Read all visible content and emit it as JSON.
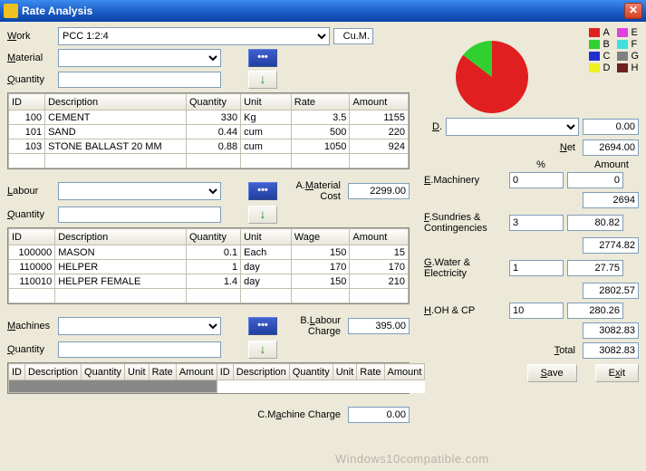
{
  "window": {
    "title": "Rate Analysis"
  },
  "work": {
    "label": "Work",
    "value": "PCC 1:2:4",
    "unit": "Cu.M."
  },
  "material": {
    "label": "Material",
    "qty_label": "Quantity",
    "value": "",
    "qty": ""
  },
  "matTable": {
    "headers": [
      "ID",
      "Description",
      "Quantity",
      "Unit",
      "Rate",
      "Amount"
    ],
    "rows": [
      {
        "id": "100",
        "desc": "CEMENT",
        "qty": "330",
        "unit": "Kg",
        "rate": "3.5",
        "amt": "1155"
      },
      {
        "id": "101",
        "desc": "SAND",
        "qty": "0.44",
        "unit": "cum",
        "rate": "500",
        "amt": "220"
      },
      {
        "id": "103",
        "desc": "STONE BALLAST 20 MM",
        "qty": "0.88",
        "unit": "cum",
        "rate": "1050",
        "amt": "924"
      }
    ]
  },
  "labour": {
    "label": "Labour",
    "qty_label": "Quantity",
    "value": "",
    "qty": ""
  },
  "matCost": {
    "label": "A.Material Cost",
    "value": "2299.00"
  },
  "labTable": {
    "headers": [
      "ID",
      "Description",
      "Quantity",
      "Unit",
      "Wage",
      "Amount"
    ],
    "rows": [
      {
        "id": "100000",
        "desc": "MASON",
        "qty": "0.1",
        "unit": "Each",
        "rate": "150",
        "amt": "15"
      },
      {
        "id": "110000",
        "desc": "HELPER",
        "qty": "1",
        "unit": "day",
        "rate": "170",
        "amt": "170"
      },
      {
        "id": "110010",
        "desc": "HELPER FEMALE",
        "qty": "1.4",
        "unit": "day",
        "rate": "150",
        "amt": "210"
      }
    ]
  },
  "machines": {
    "label": "Machines",
    "qty_label": "Quantity",
    "value": "",
    "qty": ""
  },
  "labCharge": {
    "label": "B.Labour Charge",
    "value": "395.00"
  },
  "macTable": {
    "headers": [
      "ID",
      "Description",
      "Quantity",
      "Unit",
      "Rate",
      "Amount"
    ],
    "rows": []
  },
  "macCharge": {
    "label": "C.Machine Charge",
    "value": "0.00"
  },
  "legend": [
    {
      "l": "A",
      "c": "#e02020"
    },
    {
      "l": "B",
      "c": "#30d030"
    },
    {
      "l": "C",
      "c": "#2030d0"
    },
    {
      "l": "D",
      "c": "#f0f020"
    },
    {
      "l": "E",
      "c": "#e040e0"
    },
    {
      "l": "F",
      "c": "#40e0e0"
    },
    {
      "l": "G",
      "c": "#808080"
    },
    {
      "l": "H",
      "c": "#702020"
    }
  ],
  "dsel": {
    "label": "D.",
    "value": "",
    "amt": "0.00"
  },
  "net": {
    "label": "Net",
    "value": "2694.00"
  },
  "subhead": {
    "pct": "%",
    "amt": "Amount"
  },
  "mach": {
    "label": "E.Machinery",
    "pct": "0",
    "amt": "0",
    "sub": "2694"
  },
  "sund": {
    "label": "F.Sundries & Contingencies",
    "pct": "3",
    "amt": "80.82",
    "sub": "2774.82"
  },
  "water": {
    "label": "G.Water & Electricity",
    "pct": "1",
    "amt": "27.75",
    "sub": "2802.57"
  },
  "ohcp": {
    "label": "H.OH & CP",
    "pct": "10",
    "amt": "280.26",
    "sub": "3082.83"
  },
  "total": {
    "label": "Total",
    "value": "3082.83"
  },
  "buttons": {
    "save": "Save",
    "exit": "Exit"
  },
  "chart_data": {
    "type": "pie",
    "series": [
      {
        "name": "A",
        "value": 2299,
        "color": "#e02020"
      },
      {
        "name": "B",
        "value": 395,
        "color": "#30d030"
      },
      {
        "name": "C",
        "value": 0,
        "color": "#2030d0"
      },
      {
        "name": "D",
        "value": 0,
        "color": "#f0f020"
      },
      {
        "name": "E",
        "value": 0,
        "color": "#e040e0"
      },
      {
        "name": "F",
        "value": 0,
        "color": "#40e0e0"
      },
      {
        "name": "G",
        "value": 0,
        "color": "#808080"
      },
      {
        "name": "H",
        "value": 0,
        "color": "#702020"
      }
    ]
  },
  "watermark": "Windows10compatible.com"
}
